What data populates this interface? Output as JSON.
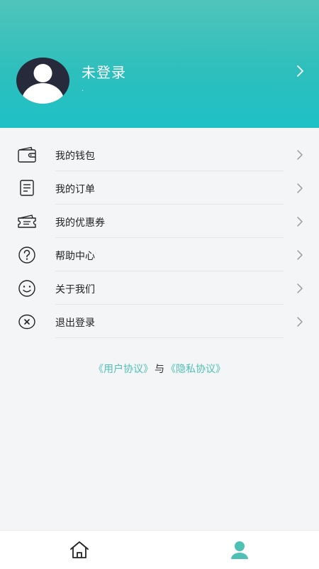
{
  "profile": {
    "name": "未登录",
    "subtitle": "."
  },
  "menu": {
    "items": [
      {
        "label": "我的钱包",
        "icon": "wallet-icon"
      },
      {
        "label": "我的订单",
        "icon": "order-list-icon"
      },
      {
        "label": "我的优惠券",
        "icon": "coupon-icon"
      },
      {
        "label": "帮助中心",
        "icon": "help-question-icon"
      },
      {
        "label": "关于我们",
        "icon": "smile-icon"
      },
      {
        "label": "退出登录",
        "icon": "logout-x-icon"
      }
    ]
  },
  "agreement": {
    "user_agreement": "《用户协议》",
    "separator": "与",
    "privacy_policy": "《隐私协议》"
  },
  "tabbar": {
    "tabs": [
      {
        "icon": "home-icon",
        "active": false
      },
      {
        "icon": "user-profile-icon",
        "active": true
      }
    ]
  },
  "colors": {
    "header_top": "#50c4ba",
    "header_bottom": "#1ec0c6",
    "accent": "#4fc0b4",
    "background": "#f4f5f7"
  }
}
